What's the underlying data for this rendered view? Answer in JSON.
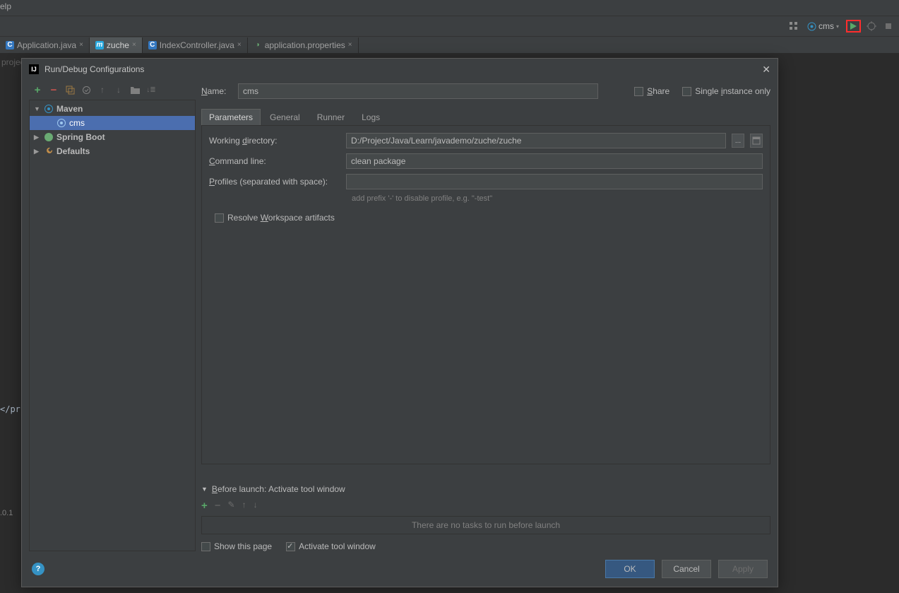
{
  "menubar": {
    "help": "elp"
  },
  "toolbar_top": {
    "config_name": "cms"
  },
  "editor_tabs": [
    {
      "label": "Application.java",
      "icon": "C",
      "icon_bg": "#3478c1"
    },
    {
      "label": "zuche",
      "icon": "m",
      "icon_bg": "#26a9e0",
      "active": true
    },
    {
      "label": "IndexController.java",
      "icon": "C",
      "icon_bg": "#3478c1"
    },
    {
      "label": "application.properties",
      "icon": "●",
      "icon_bg": "#6aab73"
    }
  ],
  "gutter": {
    "line1": "project"
  },
  "editor_fragment": "</pr",
  "bottom_text": ".0.1",
  "dialog": {
    "title": "Run/Debug Configurations",
    "name_label": "Name:",
    "name_value": "cms",
    "share_label": "Share",
    "single_instance_label": "Single instance only",
    "tabs": [
      "Parameters",
      "General",
      "Runner",
      "Logs"
    ],
    "form": {
      "working_dir_label": "Working directory:",
      "working_dir_value": "D:/Project/Java/Learn/javademo/zuche/zuche",
      "command_label": "Command line:",
      "command_value": "clean package",
      "profiles_label": "Profiles (separated with space):",
      "profiles_value": "",
      "profiles_hint": "add prefix '-' to disable profile, e.g. \"-test\"",
      "resolve_label": "Resolve Workspace artifacts"
    },
    "before_launch": {
      "header": "Before launch: Activate tool window",
      "empty_text": "There are no tasks to run before launch",
      "show_page": "Show this page",
      "activate_tool": "Activate tool window"
    },
    "tree": {
      "maven": "Maven",
      "cms": "cms",
      "spring": "Spring Boot",
      "defaults": "Defaults"
    },
    "footer": {
      "ok": "OK",
      "cancel": "Cancel",
      "apply": "Apply"
    }
  }
}
